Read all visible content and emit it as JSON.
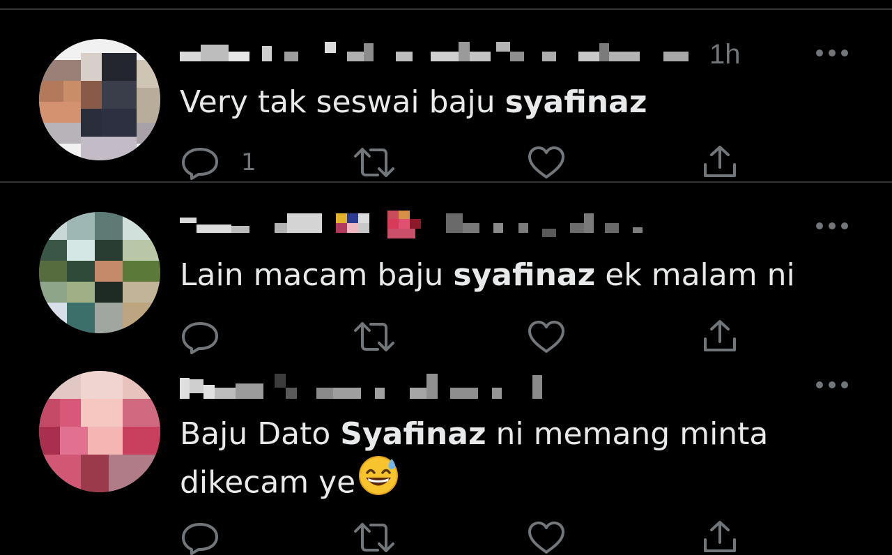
{
  "tweets": [
    {
      "timestamp": "1h",
      "text_before": "Very tak seswai baju ",
      "text_bold": "syafinaz",
      "text_after": "",
      "reply_count": "1",
      "avatar_colors": [
        "#b8835c",
        "#3a3c47",
        "#8b6c5a",
        "#232632"
      ]
    },
    {
      "timestamp": "",
      "text_before": "Lain macam baju ",
      "text_bold": "syafinaz",
      "text_after": " ek malam ni",
      "reply_count": "",
      "avatar_colors": [
        "#2f4a3a",
        "#9bb5a8",
        "#556b3c",
        "#c4b596"
      ]
    },
    {
      "timestamp": "",
      "text_before": "Baju Dato ",
      "text_bold": "Syafinaz",
      "text_after": " ni memang minta",
      "text_line2": "dikecam ye",
      "emoji": "grinning-face-with-sweat",
      "reply_count": "",
      "avatar_colors": [
        "#d85a7a",
        "#f2b7b5",
        "#b04860",
        "#e8c8c0"
      ]
    }
  ],
  "icons": {
    "more": "more-options-icon",
    "reply": "reply-icon",
    "retweet": "retweet-icon",
    "like": "like-icon",
    "share": "share-icon"
  },
  "colors": {
    "background": "#000000",
    "text": "#e7e9ea",
    "muted": "#71767b",
    "divider": "#2f3336"
  }
}
